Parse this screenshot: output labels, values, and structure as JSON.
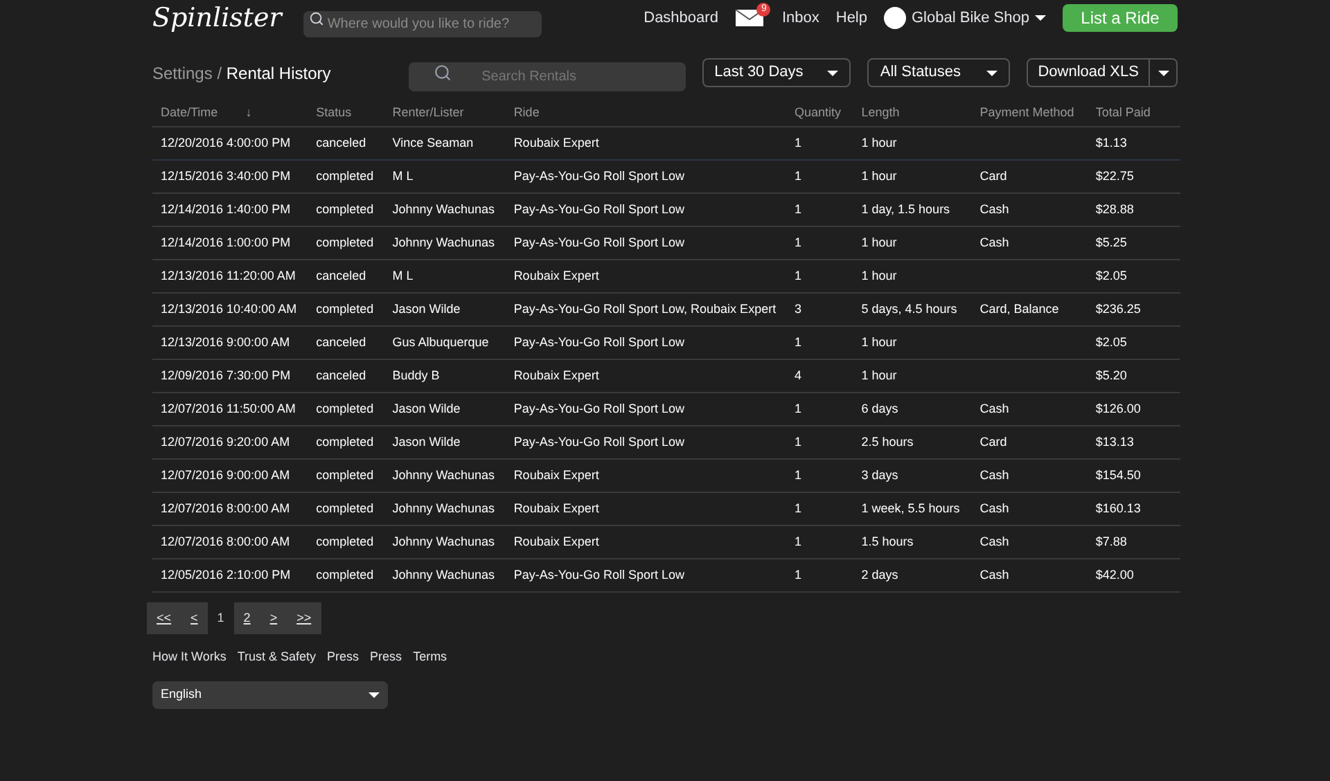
{
  "header": {
    "logo": "Spinlister",
    "search": {
      "placeholder": "Where would you like to ride?"
    },
    "nav": [
      "Dashboard"
    ],
    "inbox_badge": "9",
    "links": [
      "Inbox",
      "Help"
    ],
    "account": "Global Bike Shop",
    "cta": "List a Ride"
  },
  "breadcrumb": {
    "parent": "Settings",
    "separator": "/",
    "current": "Rental History"
  },
  "toolbar": {
    "search": {
      "placeholder": "Search Rentals"
    },
    "date_filter": "Last 30 Days",
    "status_filter": "All Statuses",
    "download": "Download XLS"
  },
  "table": {
    "sort_indicator": "↓",
    "columns": [
      "Date/Time",
      "Status",
      "Renter/Lister",
      "Ride",
      "Quantity",
      "Length",
      "Payment Method",
      "Total Paid"
    ],
    "rows": [
      [
        "12/20/2016 4:00:00 PM",
        "canceled",
        "Vince Seaman",
        "Roubaix Expert",
        "1",
        "1 hour",
        "",
        "$1.13"
      ],
      [
        "12/15/2016 3:40:00 PM",
        "completed",
        "M L",
        "Pay-As-You-Go Roll Sport Low",
        "1",
        "1 hour",
        "Card",
        "$22.75"
      ],
      [
        "12/14/2016 1:40:00 PM",
        "completed",
        "Johnny Wachunas",
        "Pay-As-You-Go Roll Sport Low",
        "1",
        "1 day, 1.5 hours",
        "Cash",
        "$28.88"
      ],
      [
        "12/14/2016 1:00:00 PM",
        "completed",
        "Johnny Wachunas",
        "Pay-As-You-Go Roll Sport Low",
        "1",
        "1 hour",
        "Cash",
        "$5.25"
      ],
      [
        "12/13/2016 11:20:00 AM",
        "canceled",
        "M L",
        "Roubaix Expert",
        "1",
        "1 hour",
        "",
        "$2.05"
      ],
      [
        "12/13/2016 10:40:00 AM",
        "completed",
        "Jason Wilde",
        "Pay-As-You-Go Roll Sport Low, Roubaix Expert",
        "3",
        "5 days, 4.5 hours",
        "Card, Balance",
        "$236.25"
      ],
      [
        "12/13/2016 9:00:00 AM",
        "canceled",
        "Gus Albuquerque",
        "Pay-As-You-Go Roll Sport Low",
        "1",
        "1 hour",
        "",
        "$2.05"
      ],
      [
        "12/09/2016 7:30:00 PM",
        "canceled",
        "Buddy B",
        "Roubaix Expert",
        "4",
        "1 hour",
        "",
        "$5.20"
      ],
      [
        "12/07/2016 11:50:00 AM",
        "completed",
        "Jason Wilde",
        "Pay-As-You-Go Roll Sport Low",
        "1",
        "6 days",
        "Cash",
        "$126.00"
      ],
      [
        "12/07/2016 9:20:00 AM",
        "completed",
        "Jason Wilde",
        "Pay-As-You-Go Roll Sport Low",
        "1",
        "2.5 hours",
        "Card",
        "$13.13"
      ],
      [
        "12/07/2016 9:00:00 AM",
        "completed",
        "Johnny Wachunas",
        "Roubaix Expert",
        "1",
        "3 days",
        "Cash",
        "$154.50"
      ],
      [
        "12/07/2016 8:00:00 AM",
        "completed",
        "Johnny Wachunas",
        "Roubaix Expert",
        "1",
        "1 week, 5.5 hours",
        "Cash",
        "$160.13"
      ],
      [
        "12/07/2016 8:00:00 AM",
        "completed",
        "Johnny Wachunas",
        "Roubaix Expert",
        "1",
        "1.5 hours",
        "Cash",
        "$7.88"
      ],
      [
        "12/05/2016 2:10:00 PM",
        "completed",
        "Johnny Wachunas",
        "Pay-As-You-Go Roll Sport Low",
        "1",
        "2 days",
        "Cash",
        "$42.00"
      ]
    ]
  },
  "pagination": [
    {
      "label": "<<",
      "kind": "nav"
    },
    {
      "label": "<",
      "kind": "nav"
    },
    {
      "label": "1",
      "kind": "page",
      "selected": true
    },
    {
      "label": "2",
      "kind": "page",
      "selected": false
    },
    {
      "label": ">",
      "kind": "nav"
    },
    {
      "label": ">>",
      "kind": "nav"
    }
  ],
  "footer": {
    "links": [
      "How It Works",
      "Trust & Safety",
      "Press",
      "Press",
      "Terms"
    ],
    "language": "English"
  }
}
